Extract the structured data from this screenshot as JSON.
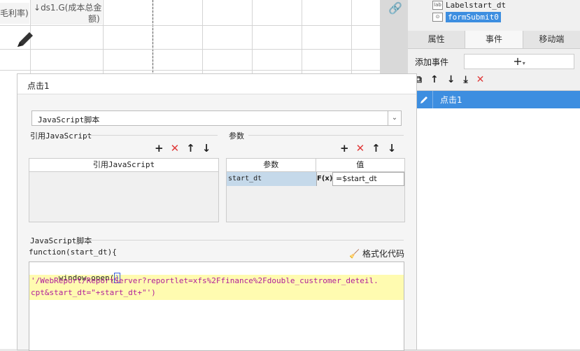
{
  "sheet": {
    "col_header_1": "毛利率)",
    "col_header_2_line1": "ds1.G(成本总金",
    "col_header_2_line2": "额)"
  },
  "right_panel": {
    "tree": [
      {
        "icon": "label-icon",
        "label": "Labelstart_dt"
      },
      {
        "icon": "form-submit-icon",
        "label": "formSubmit0",
        "selected": true
      }
    ],
    "tabs": [
      "属性",
      "事件",
      "移动端"
    ],
    "active_tab": "事件",
    "add_event_label": "添加事件",
    "add_event_button": "+",
    "event_item_label": "点击1"
  },
  "dialog": {
    "title": "点击1",
    "type_select_value": "JavaScript脚本",
    "ref_js_section": "引用JavaScript",
    "ref_js_column": "引用JavaScript",
    "params_section": "参数",
    "params_columns": [
      "参数",
      "值"
    ],
    "params_rows": [
      {
        "name": "start_dt",
        "fx": "F(x)",
        "value": "=$start_dt"
      }
    ],
    "script_section": "JavaScript脚本",
    "function_signature": "function(start_dt){",
    "format_button": "格式化代码",
    "code_lines": [
      "window.open(",
      "'/WebReport/ReportServer?reportlet=xfs%2Ffinance%2Fdouble_custromer_deteil.",
      "cpt&start_dt=\"+start_dt+\"')"
    ]
  },
  "colors": {
    "selection_blue": "#3d8ee0",
    "delete_red": "#e03a3a",
    "string_purple": "#b0209a",
    "highlight_yellow": "#fffbb0"
  }
}
